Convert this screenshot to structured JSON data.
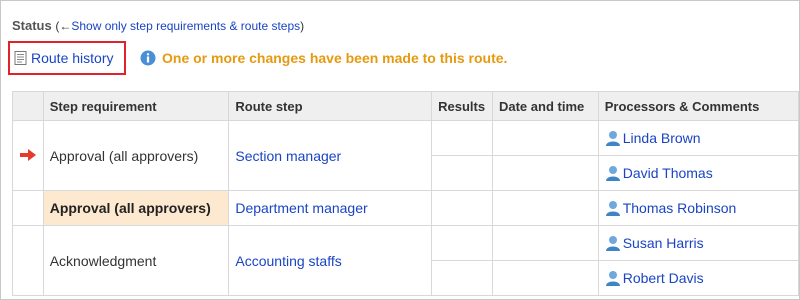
{
  "status": {
    "title": "Status",
    "paren_open": "(←",
    "link": "Show only step requirements & route steps",
    "paren_close": ")"
  },
  "route_history": {
    "label": "Route history",
    "icon": "document-icon"
  },
  "info": {
    "icon": "info-icon",
    "message": "One or more changes have been made to this route."
  },
  "table": {
    "headers": [
      "Step requirement",
      "Route step",
      "Results",
      "Date and time",
      "Processors & Comments"
    ],
    "rows": [
      {
        "current_marker": "arrow-right-icon",
        "requirement": "Approval (all approvers)",
        "route_step": "Section manager",
        "processors": [
          "Linda Brown",
          "David Thomas"
        ]
      },
      {
        "requirement": "Approval (all approvers)",
        "highlighted": true,
        "route_step": "Department manager",
        "processors": [
          "Thomas Robinson"
        ]
      },
      {
        "requirement": "Acknowledgment",
        "route_step": "Accounting staffs",
        "processors": [
          "Susan Harris",
          "Robert Davis"
        ]
      }
    ]
  },
  "colors": {
    "link": "#1a44c4",
    "warning_text": "#e59a10",
    "highlight_bg": "#fde9cf",
    "focus_border": "#e0232b",
    "header_bg": "#efefef"
  }
}
